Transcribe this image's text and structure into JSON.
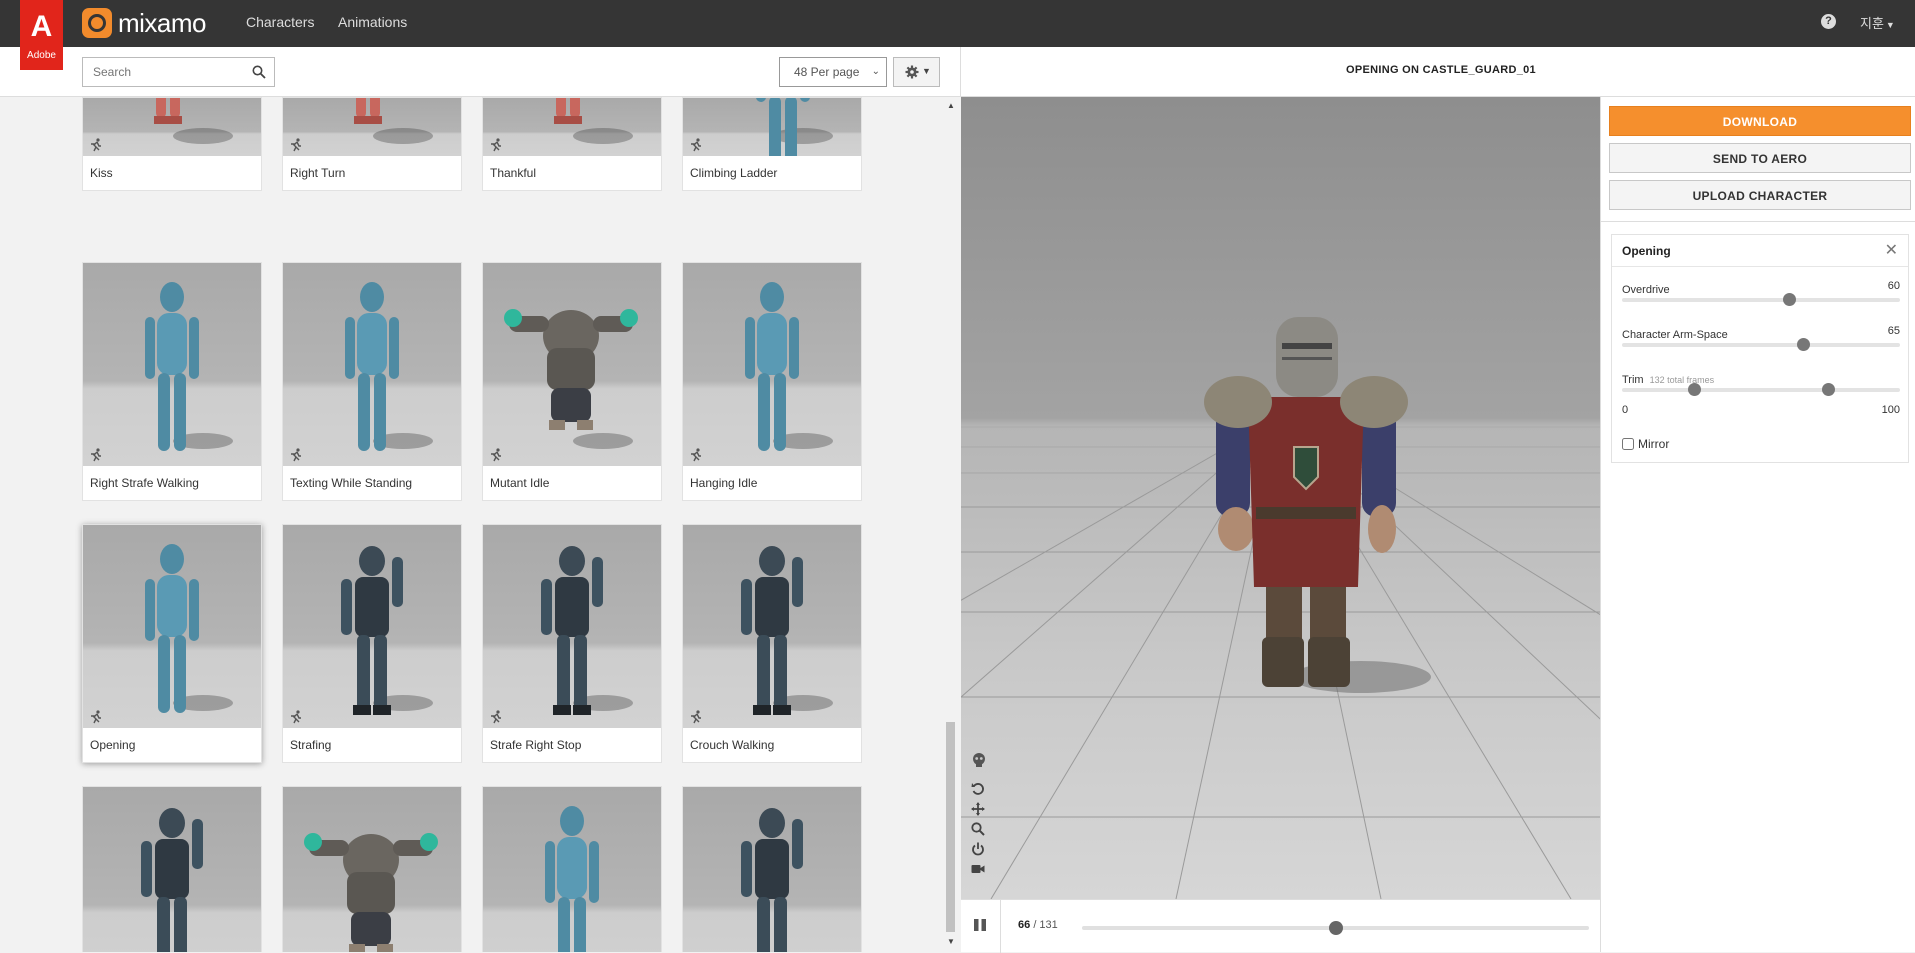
{
  "app": {
    "logo_text": "mixamo",
    "adobe_label": "Adobe",
    "adobe_mark": "A"
  },
  "nav": {
    "characters": "Characters",
    "animations": "Animations"
  },
  "user": {
    "name": "지훈",
    "help_glyph": "?"
  },
  "toolbar": {
    "search_placeholder": "Search",
    "per_page": "48 Per page"
  },
  "grid": {
    "cards": [
      {
        "label": "Kiss",
        "figure": "red"
      },
      {
        "label": "Right Turn",
        "figure": "red"
      },
      {
        "label": "Thankful",
        "figure": "red"
      },
      {
        "label": "Climbing Ladder",
        "figure": "blue"
      },
      {
        "label": "Right Strafe Walking",
        "figure": "blue"
      },
      {
        "label": "Texting While Standing",
        "figure": "blue"
      },
      {
        "label": "Mutant Idle",
        "figure": "mutant"
      },
      {
        "label": "Hanging Idle",
        "figure": "blue"
      },
      {
        "label": "Opening",
        "figure": "blue",
        "selected": true
      },
      {
        "label": "Strafing",
        "figure": "soldier"
      },
      {
        "label": "Strafe Right Stop",
        "figure": "soldier"
      },
      {
        "label": "Crouch Walking",
        "figure": "soldier"
      },
      {
        "label": "",
        "figure": "soldier"
      },
      {
        "label": "",
        "figure": "mutant"
      },
      {
        "label": "",
        "figure": "blue"
      },
      {
        "label": "",
        "figure": "soldier"
      }
    ]
  },
  "viewer": {
    "title": "OPENING ON CASTLE_GUARD_01",
    "frame_current": "66",
    "frame_total": "/ 131",
    "playhead_fraction": 0.5
  },
  "actions": {
    "download": "DOWNLOAD",
    "send_to_aero": "SEND TO AERO",
    "upload_character": "UPLOAD CHARACTER"
  },
  "animation_settings": {
    "title": "Opening",
    "overdrive_label": "Overdrive",
    "overdrive_value": "60",
    "overdrive_fraction": 0.6,
    "arm_space_label": "Character Arm-Space",
    "arm_space_value": "65",
    "arm_space_fraction": 0.65,
    "trim_label": "Trim",
    "trim_sub": "132 total frames",
    "trim_start_fraction": 0.26,
    "trim_end_fraction": 0.74,
    "trim_min": "0",
    "trim_max": "100",
    "mirror_label": "Mirror"
  },
  "colors": {
    "accent": "#f58f2d",
    "topbar": "#353535",
    "adobe_red": "#e1251b"
  }
}
